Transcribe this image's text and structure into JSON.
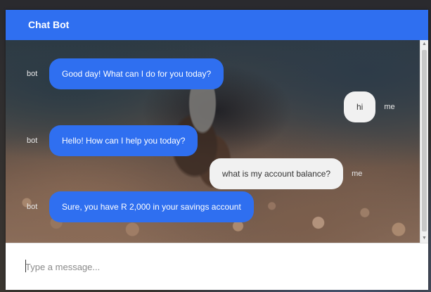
{
  "header": {
    "title": "Chat Bot"
  },
  "messages": [
    {
      "sender": "bot",
      "text": "Good day! What can I do for you today?"
    },
    {
      "sender": "me",
      "text": "hi"
    },
    {
      "sender": "bot",
      "text": "Hello! How can I help you today?"
    },
    {
      "sender": "me",
      "text": "what is my account balance?"
    },
    {
      "sender": "bot",
      "text": "Sure, you have R 2,000 in your savings account"
    }
  ],
  "input": {
    "placeholder": "Type a message..."
  },
  "colors": {
    "header_bg": "#2f6ff0",
    "bot_bubble": "#2f6ff0",
    "user_bubble": "#f1f1f1"
  },
  "icons": {
    "scroll_up": "scroll-up-arrow",
    "scroll_down": "scroll-down-arrow"
  }
}
